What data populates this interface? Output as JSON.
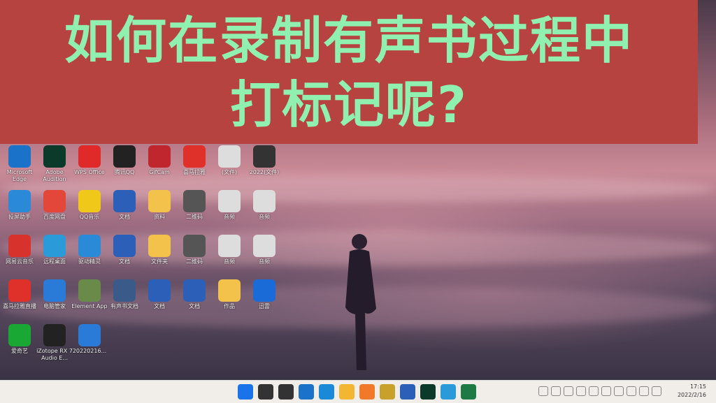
{
  "banner": {
    "line1": "如何在录制有声书过程中",
    "line2": "打标记呢?"
  },
  "desktop_icons": [
    {
      "label": "Microsoft Edge",
      "icon": "edge-icon",
      "color": "#1a73c8"
    },
    {
      "label": "Adobe Audition",
      "icon": "audition-icon",
      "color": "#0c3a2a"
    },
    {
      "label": "WPS Office",
      "icon": "wps-icon",
      "color": "#e02a2a"
    },
    {
      "label": "腾讯QQ",
      "icon": "qq-icon",
      "color": "#222222"
    },
    {
      "label": "GifCam",
      "icon": "app-icon",
      "color": "#c0262e"
    },
    {
      "label": "喜马拉雅",
      "icon": "ting-icon",
      "color": "#e0302a"
    },
    {
      "label": "(文件)",
      "icon": "audio-file-icon",
      "color": "#dddddd"
    },
    {
      "label": "2022(文件)",
      "icon": "video-file-icon",
      "color": "#333333"
    },
    {
      "label": "投屏助手",
      "icon": "cast-icon",
      "color": "#2a8ad8"
    },
    {
      "label": "百度网盘",
      "icon": "cloud-icon",
      "color": "#e2473a"
    },
    {
      "label": "QQ音乐",
      "icon": "music-icon",
      "color": "#f0c81a"
    },
    {
      "label": "文档",
      "icon": "word-doc-icon",
      "color": "#2b5fb8"
    },
    {
      "label": "资料",
      "icon": "folder-icon",
      "color": "#f2c24a"
    },
    {
      "label": "二维码",
      "icon": "qr-icon",
      "color": "#555555"
    },
    {
      "label": "音频",
      "icon": "audio-file-icon",
      "color": "#dddddd"
    },
    {
      "label": "音频",
      "icon": "audio-file-icon",
      "color": "#dddddd"
    },
    {
      "label": "网易云音乐",
      "icon": "netease-icon",
      "color": "#d8322c"
    },
    {
      "label": "远程桌面",
      "icon": "remote-icon",
      "color": "#2a9ad8"
    },
    {
      "label": "驱动精灵",
      "icon": "driver-icon",
      "color": "#2a8ad8"
    },
    {
      "label": "文档",
      "icon": "word-doc-icon",
      "color": "#2b5fb8"
    },
    {
      "label": "文件夹",
      "icon": "folder-icon",
      "color": "#f2c24a"
    },
    {
      "label": "二维码",
      "icon": "qr-icon",
      "color": "#555555"
    },
    {
      "label": "音频",
      "icon": "audio-file-icon",
      "color": "#dddddd"
    },
    {
      "label": "音频",
      "icon": "audio-file-icon",
      "color": "#dddddd"
    },
    {
      "label": "喜马拉雅直播",
      "icon": "ting-icon",
      "color": "#e0302a"
    },
    {
      "label": "电脑管家",
      "icon": "shield-icon",
      "color": "#2a7ad8"
    },
    {
      "label": "Element App",
      "icon": "element-icon",
      "color": "#6a8a4a"
    },
    {
      "label": "有声书文档",
      "icon": "doc-icon",
      "color": "#3a5a8a"
    },
    {
      "label": "文档",
      "icon": "word-doc-icon",
      "color": "#2b5fb8"
    },
    {
      "label": "文档",
      "icon": "word-doc-icon",
      "color": "#2b5fb8"
    },
    {
      "label": "作品",
      "icon": "folder-icon",
      "color": "#f2c24a"
    },
    {
      "label": "迅雷",
      "icon": "thunder-icon",
      "color": "#1a6ad8"
    },
    {
      "label": "爱奇艺",
      "icon": "iqiyi-icon",
      "color": "#1aa834"
    },
    {
      "label": "iZotope RX 7 Audio E...",
      "icon": "izotope-icon",
      "color": "#222222"
    },
    {
      "label": "20220216...",
      "icon": "video-file-icon",
      "color": "#2a7ad8"
    }
  ],
  "taskbar": {
    "icons": [
      {
        "name": "windows-start-icon",
        "color": "#1a73e8"
      },
      {
        "name": "search-icon",
        "color": "#333333"
      },
      {
        "name": "task-view-icon",
        "color": "#333333"
      },
      {
        "name": "widgets-icon",
        "color": "#1a73c8"
      },
      {
        "name": "edge-icon",
        "color": "#1a8ad8"
      },
      {
        "name": "explorer-icon",
        "color": "#f2b633"
      },
      {
        "name": "browser-icon",
        "color": "#f07a2a"
      },
      {
        "name": "izotope-icon",
        "color": "#c8a02a"
      },
      {
        "name": "word-icon",
        "color": "#2b5fb8"
      },
      {
        "name": "audition-icon",
        "color": "#0c3a2a"
      },
      {
        "name": "remote-icon",
        "color": "#2a9ad8"
      },
      {
        "name": "excel-icon",
        "color": "#1d7a44"
      }
    ],
    "tray_icons": [
      "chevron-up-icon",
      "network-icon",
      "shield-icon",
      "qq-icon",
      "mic-icon",
      "volume-icon",
      "app-icon",
      "wifi-icon",
      "speaker-icon",
      "battery-icon"
    ],
    "clock_time": "17:15",
    "clock_date": "2022/2/16"
  }
}
